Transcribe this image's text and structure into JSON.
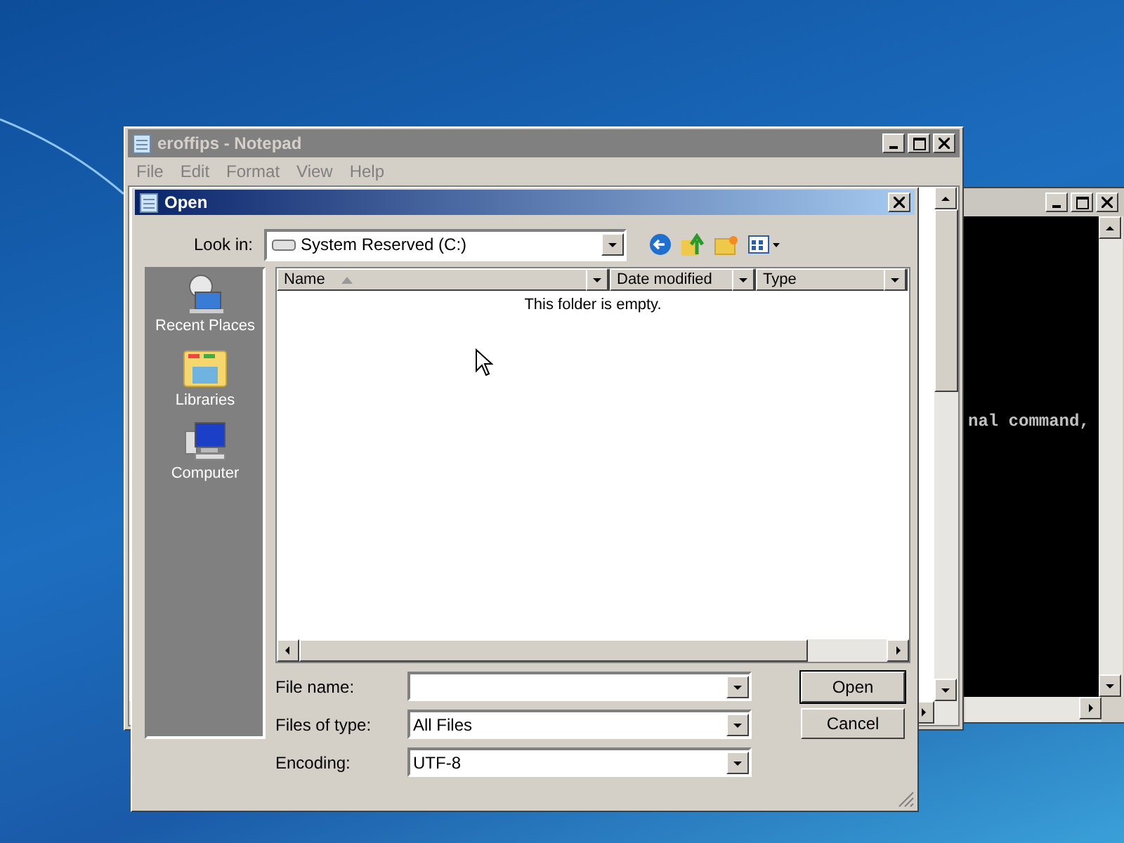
{
  "console_window": {
    "text": "nal command,"
  },
  "notepad": {
    "title": "eroffips - Notepad",
    "menu": [
      {
        "label": "File",
        "disabled": true
      },
      {
        "label": "Edit",
        "disabled": true
      },
      {
        "label": "Format",
        "disabled": true
      },
      {
        "label": "View",
        "disabled": true
      },
      {
        "label": "Help",
        "disabled": true
      }
    ]
  },
  "open_dialog": {
    "title": "Open",
    "look_in_label": "Look in:",
    "look_in_value": "System Reserved (C:)",
    "places": [
      {
        "label": "Recent Places",
        "kind": "recent"
      },
      {
        "label": "Libraries",
        "kind": "libraries"
      },
      {
        "label": "Computer",
        "kind": "computer"
      }
    ],
    "columns": [
      {
        "label": "Name",
        "sorted": true
      },
      {
        "label": "Date modified",
        "sorted": false
      },
      {
        "label": "Type",
        "sorted": false
      }
    ],
    "empty_message": "This folder is empty.",
    "fields": [
      {
        "label": "File name:"
      },
      {
        "label": "Files of type:",
        "value": "All Files"
      },
      {
        "label": "Encoding:",
        "value": "UTF-8"
      }
    ],
    "buttons": [
      {
        "label": "Open",
        "default": true
      },
      {
        "label": "Cancel",
        "default": false
      }
    ]
  }
}
